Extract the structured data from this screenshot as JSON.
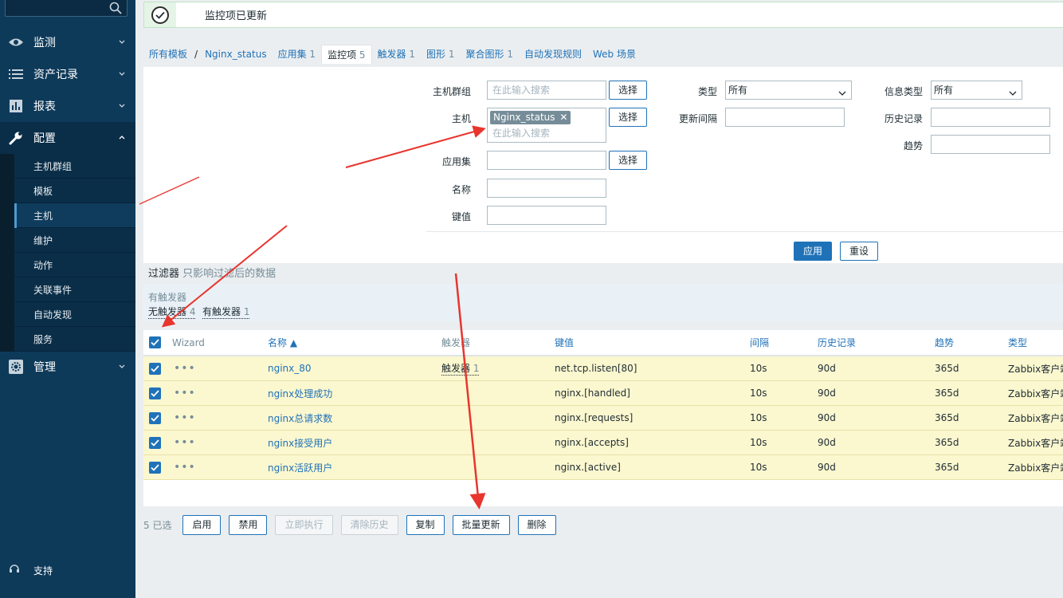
{
  "sidebar": {
    "menu": [
      {
        "label": "监测",
        "icon": "eye-icon"
      },
      {
        "label": "资产记录",
        "icon": "list-icon"
      },
      {
        "label": "报表",
        "icon": "bar-chart-icon"
      },
      {
        "label": "配置",
        "icon": "wrench-icon"
      },
      {
        "label": "管理",
        "icon": "gear-icon"
      }
    ],
    "submenu": [
      "主机群组",
      "模板",
      "主机",
      "维护",
      "动作",
      "关联事件",
      "自动发现",
      "服务"
    ],
    "support": "支持"
  },
  "message": "监控项已更新",
  "tabs": {
    "all_templates": "所有模板",
    "template": "Nginx_status",
    "apps": "应用集",
    "apps_count": "1",
    "items": "监控项",
    "items_count": "5",
    "triggers": "触发器",
    "triggers_count": "1",
    "graphs": "图形",
    "graphs_count": "1",
    "screens": "聚合图形",
    "screens_count": "1",
    "discovery": "自动发现规则",
    "web": "Web 场景"
  },
  "filter": {
    "host_group_label": "主机群组",
    "host_label": "主机",
    "app_label": "应用集",
    "name_label": "名称",
    "key_label": "键值",
    "type_label": "类型",
    "interval_label": "更新间隔",
    "info_type_label": "信息类型",
    "history_label": "历史记录",
    "trends_label": "趋势",
    "search_placeholder": "在此输入搜索",
    "select_btn": "选择",
    "host_chip": "Nginx_status",
    "type_value": "所有",
    "info_type_value": "所有",
    "apply": "应用",
    "reset": "重设",
    "title": "过滤器",
    "subtitle": "只影响过滤后的数据",
    "trigger_heading": "有触发器",
    "no_trigger": "无触发器",
    "no_trigger_count": "4",
    "has_trigger": "有触发器",
    "has_trigger_count": "1"
  },
  "table": {
    "headers": {
      "wizard": "Wizard",
      "name": "名称 ▲",
      "triggers": "触发器",
      "key": "键值",
      "interval": "间隔",
      "history": "历史记录",
      "trends": "趋势",
      "type": "类型"
    },
    "rows": [
      {
        "name": "nginx_80",
        "trigger": "触发器",
        "trigger_count": "1",
        "key": "net.tcp.listen[80]",
        "interval": "10s",
        "history": "90d",
        "trends": "365d",
        "type": "Zabbix客户端"
      },
      {
        "name": "nginx处理成功",
        "trigger": "",
        "trigger_count": "",
        "key": "nginx.[handled]",
        "interval": "10s",
        "history": "90d",
        "trends": "365d",
        "type": "Zabbix客户端"
      },
      {
        "name": "nginx总请求数",
        "trigger": "",
        "trigger_count": "",
        "key": "nginx.[requests]",
        "interval": "10s",
        "history": "90d",
        "trends": "365d",
        "type": "Zabbix客户端"
      },
      {
        "name": "nginx接受用户",
        "trigger": "",
        "trigger_count": "",
        "key": "nginx.[accepts]",
        "interval": "10s",
        "history": "90d",
        "trends": "365d",
        "type": "Zabbix客户端"
      },
      {
        "name": "nginx活跃用户",
        "trigger": "",
        "trigger_count": "",
        "key": "nginx.[active]",
        "interval": "10s",
        "history": "90d",
        "trends": "365d",
        "type": "Zabbix客户端"
      }
    ]
  },
  "actions": {
    "selected": "5 已选",
    "enable": "启用",
    "disable": "禁用",
    "check_now": "立即执行",
    "clear_history": "清除历史",
    "copy": "复制",
    "mass_update": "批量更新",
    "delete": "删除"
  },
  "colors": {
    "accent": "#1f72b8",
    "sidebar": "#0e3a5a",
    "selected_row": "#fbf7cf",
    "annotation_arrow": "#e8352e"
  }
}
